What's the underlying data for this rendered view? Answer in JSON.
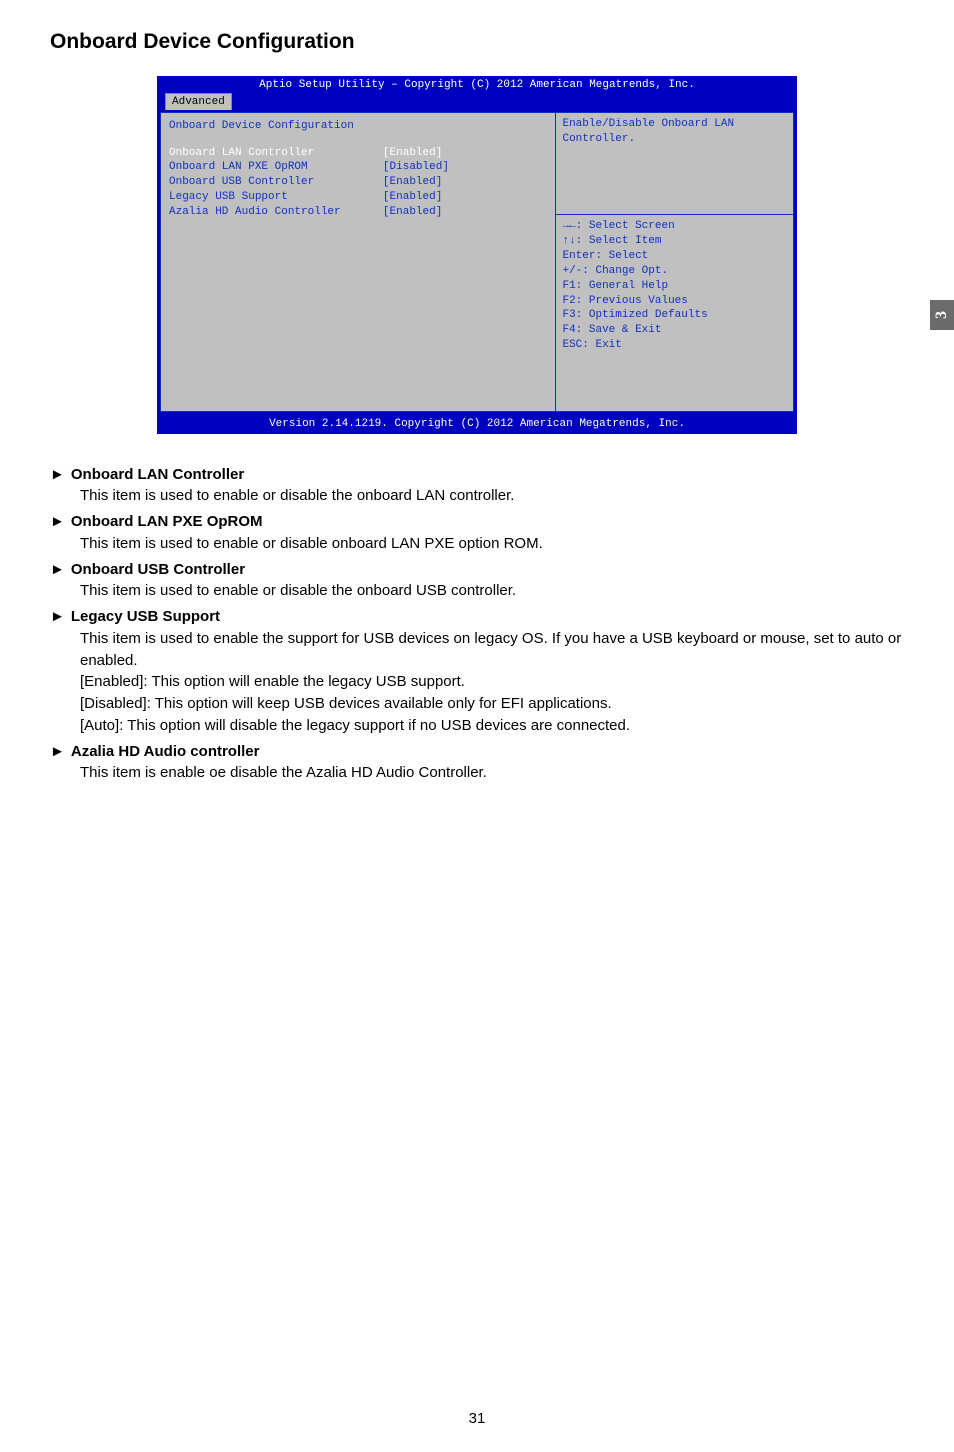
{
  "page": {
    "title": "Onboard Device Configuration",
    "side_tab": "3",
    "page_number": "31"
  },
  "bios": {
    "header": "Aptio Setup Utility – Copyright (C) 2012 American Megatrends, Inc.",
    "tab": "Advanced",
    "footer": "Version 2.14.1219. Copyright (C) 2012 American Megatrends, Inc.",
    "section_title": "Onboard Device Configuration",
    "description": "Enable/Disable Onboard LAN Controller.",
    "rows": [
      {
        "label": "Onboard LAN Controller",
        "value": "[Enabled]",
        "selected": true
      },
      {
        "label": "Onboard LAN PXE OpROM",
        "value": "[Disabled]",
        "selected": false
      },
      {
        "label": "Onboard USB Controller",
        "value": "[Enabled]",
        "selected": false
      },
      {
        "label": "Legacy USB Support",
        "value": "[Enabled]",
        "selected": false
      },
      {
        "label": "Azalia HD Audio Controller",
        "value": "[Enabled]",
        "selected": false
      }
    ],
    "help": [
      "→←: Select Screen",
      "↑↓: Select Item",
      "Enter: Select",
      "+/-: Change Opt.",
      "F1: General Help",
      "F2: Previous Values",
      "F3: Optimized Defaults",
      "F4: Save & Exit",
      "ESC: Exit"
    ]
  },
  "content": {
    "items": [
      {
        "heading": "Onboard LAN Controller",
        "lines": [
          "This item is used to enable or disable the onboard LAN controller."
        ]
      },
      {
        "heading": "Onboard LAN PXE OpROM",
        "lines": [
          "This item is used to enable or disable onboard LAN PXE option ROM."
        ]
      },
      {
        "heading": "Onboard USB Controller",
        "lines": [
          "This item is used to enable or disable the onboard USB controller."
        ]
      },
      {
        "heading": "Legacy USB Support",
        "lines": [
          "This item is used to enable the support for USB devices on legacy OS. If you have a USB keyboard or mouse, set to auto or enabled.",
          "[Enabled]: This option will enable the legacy USB support.",
          "[Disabled]: This option will keep USB devices available only for EFI applications.",
          "[Auto]: This option will disable the legacy support if no USB devices are connected."
        ]
      },
      {
        "heading": "Azalia HD Audio controller",
        "lines": [
          "This item is enable oe disable the Azalia HD Audio Controller."
        ]
      }
    ]
  }
}
